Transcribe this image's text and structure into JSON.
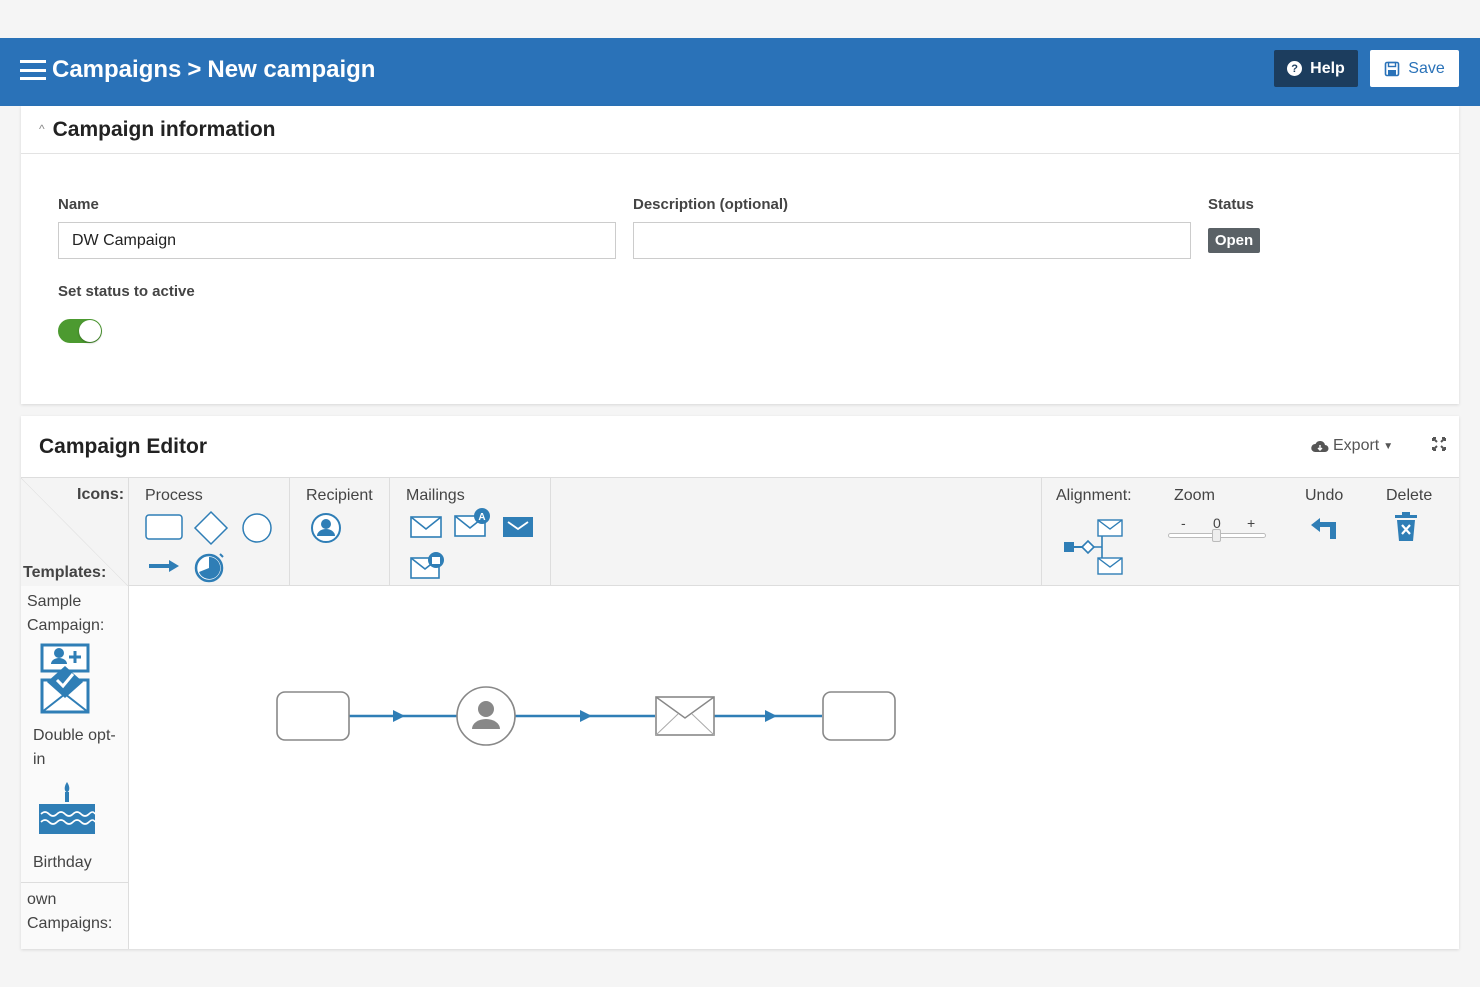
{
  "header": {
    "breadcrumb_root": "Campaigns",
    "breadcrumb_separator": ">",
    "breadcrumb_current": "New campaign",
    "help_label": "Help",
    "save_label": "Save",
    "bg_color": "#2a72b8"
  },
  "info": {
    "section_title": "Campaign information",
    "name_label": "Name",
    "name_value": "DW Campaign",
    "description_label": "Description (optional)",
    "description_value": "",
    "status_label": "Status",
    "status_value": "Open",
    "active_label": "Set status to active",
    "active_on": true
  },
  "editor": {
    "title": "Campaign Editor",
    "export_label": "Export",
    "toolbar": {
      "icons_label": "Icons:",
      "templates_label": "Templates:",
      "process_label": "Process",
      "recipient_label": "Recipient",
      "mailings_label": "Mailings",
      "alignment_label": "Alignment:",
      "zoom_label": "Zoom",
      "zoom_minus": "-",
      "zoom_value": "0",
      "zoom_plus": "+",
      "undo_label": "Undo",
      "delete_label": "Delete"
    },
    "sidebar": {
      "sample_label": "Sample Campaign:",
      "template_1": "Double opt-in",
      "template_2": "Birthday",
      "own_label": "own Campaigns:"
    },
    "flow_nodes": [
      "start-node",
      "recipient-node",
      "mailing-node",
      "end-node"
    ],
    "accent_color": "#2f7eb6"
  }
}
